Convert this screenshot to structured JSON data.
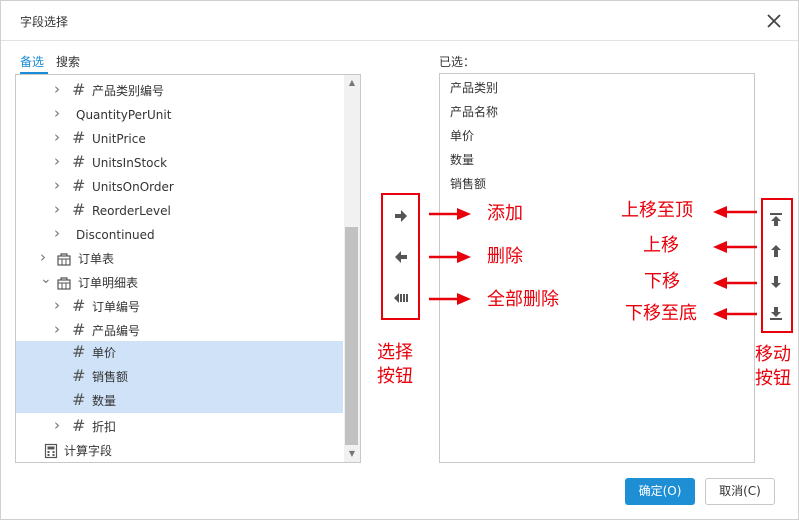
{
  "dialog": {
    "title": "字段选择",
    "tabs": [
      "备选",
      "搜索"
    ]
  },
  "tree": {
    "rows": [
      {
        "label": "产品类别编号",
        "kind": "field",
        "expand": "collapsed",
        "selected": false
      },
      {
        "label": "QuantityPerUnit",
        "kind": "field-plain",
        "expand": "collapsed",
        "selected": false
      },
      {
        "label": "UnitPrice",
        "kind": "field",
        "expand": "collapsed",
        "selected": false
      },
      {
        "label": "UnitsInStock",
        "kind": "field",
        "expand": "collapsed",
        "selected": false
      },
      {
        "label": "UnitsOnOrder",
        "kind": "field",
        "expand": "collapsed",
        "selected": false
      },
      {
        "label": "ReorderLevel",
        "kind": "field",
        "expand": "collapsed",
        "selected": false
      },
      {
        "label": "Discontinued",
        "kind": "field-plain",
        "expand": "collapsed",
        "selected": false
      },
      {
        "label": "订单表",
        "kind": "table",
        "expand": "collapsed",
        "selected": false
      },
      {
        "label": "订单明细表",
        "kind": "table",
        "expand": "expanded",
        "selected": false
      },
      {
        "label": "订单编号",
        "kind": "field",
        "expand": "collapsed",
        "selected": false
      },
      {
        "label": "产品编号",
        "kind": "field",
        "expand": "collapsed",
        "selected": false
      },
      {
        "label": "单价",
        "kind": "field",
        "expand": "none",
        "selected": true
      },
      {
        "label": "销售额",
        "kind": "field",
        "expand": "none",
        "selected": true
      },
      {
        "label": "数量",
        "kind": "field",
        "expand": "none",
        "selected": true
      },
      {
        "label": "折扣",
        "kind": "field",
        "expand": "collapsed",
        "selected": false
      },
      {
        "label": "计算字段",
        "kind": "calc",
        "expand": "none",
        "selected": false
      }
    ]
  },
  "selected_panel": {
    "label": "已选：",
    "items": [
      "产品类别",
      "产品名称",
      "单价",
      "数量",
      "销售额"
    ]
  },
  "select_buttons": {
    "icons": [
      "arrow-right-icon",
      "arrow-left-icon",
      "double-arrow-left-icon"
    ],
    "annotations": [
      "添加",
      "删除",
      "全部删除"
    ],
    "group_label": [
      "选择",
      "按钮"
    ]
  },
  "move_buttons": {
    "icons": [
      "move-top-icon",
      "move-up-icon",
      "move-down-icon",
      "move-bottom-icon"
    ],
    "annotations": [
      "上移至顶",
      "上移",
      "下移",
      "下移至底"
    ],
    "group_label": [
      "移动",
      "按钮"
    ]
  },
  "footer": {
    "ok_label": "确定(O)",
    "cancel_label": "取消(C)"
  },
  "colors": {
    "accent": "#1a8bd6",
    "ok_button": "#1e8fd5",
    "annotation_red": "#e8000b",
    "selected_row": "#cfe2f7"
  }
}
